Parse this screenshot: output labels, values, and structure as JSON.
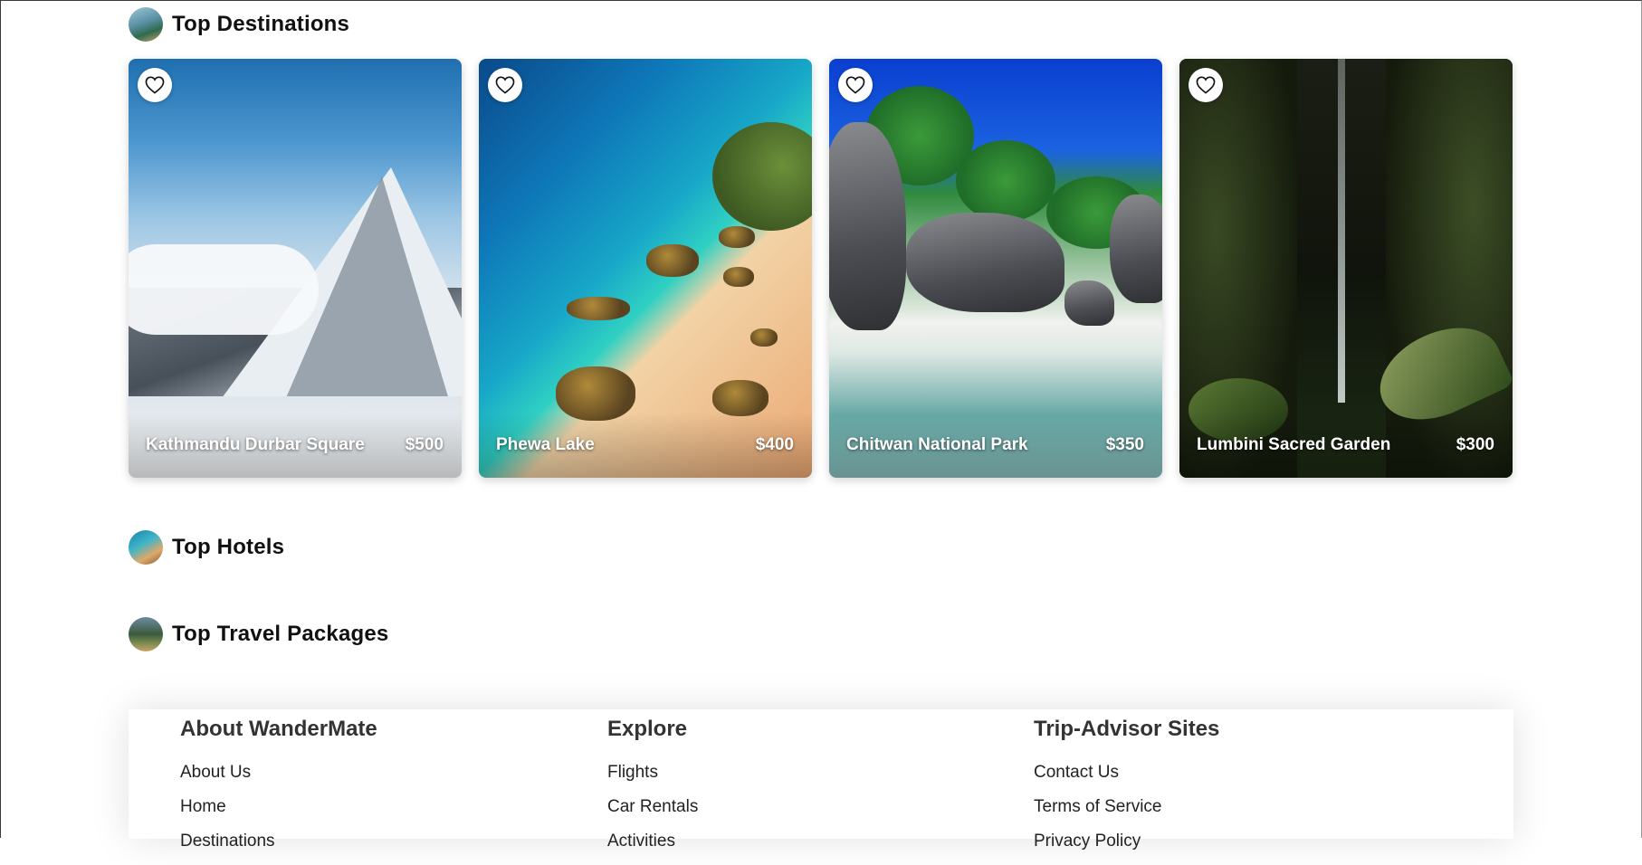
{
  "sections": {
    "destinations": {
      "title": "Top Destinations"
    },
    "hotels": {
      "title": "Top Hotels"
    },
    "packages": {
      "title": "Top Travel Packages"
    }
  },
  "destinations": [
    {
      "name": "Kathmandu Durbar Square",
      "price": "$500",
      "icon": "heart-outline-icon"
    },
    {
      "name": "Phewa Lake",
      "price": "$400",
      "icon": "heart-outline-icon"
    },
    {
      "name": "Chitwan National Park",
      "price": "$350",
      "icon": "heart-outline-icon"
    },
    {
      "name": "Lumbini Sacred Garden",
      "price": "$300",
      "icon": "heart-outline-icon"
    }
  ],
  "footer": {
    "columns": [
      {
        "title": "About WanderMate",
        "links": [
          "About Us",
          "Home",
          "Destinations"
        ]
      },
      {
        "title": "Explore",
        "links": [
          "Flights",
          "Car Rentals",
          "Activities"
        ]
      },
      {
        "title": "Trip-Advisor Sites",
        "links": [
          "Contact Us",
          "Terms of Service",
          "Privacy Policy"
        ]
      }
    ]
  }
}
